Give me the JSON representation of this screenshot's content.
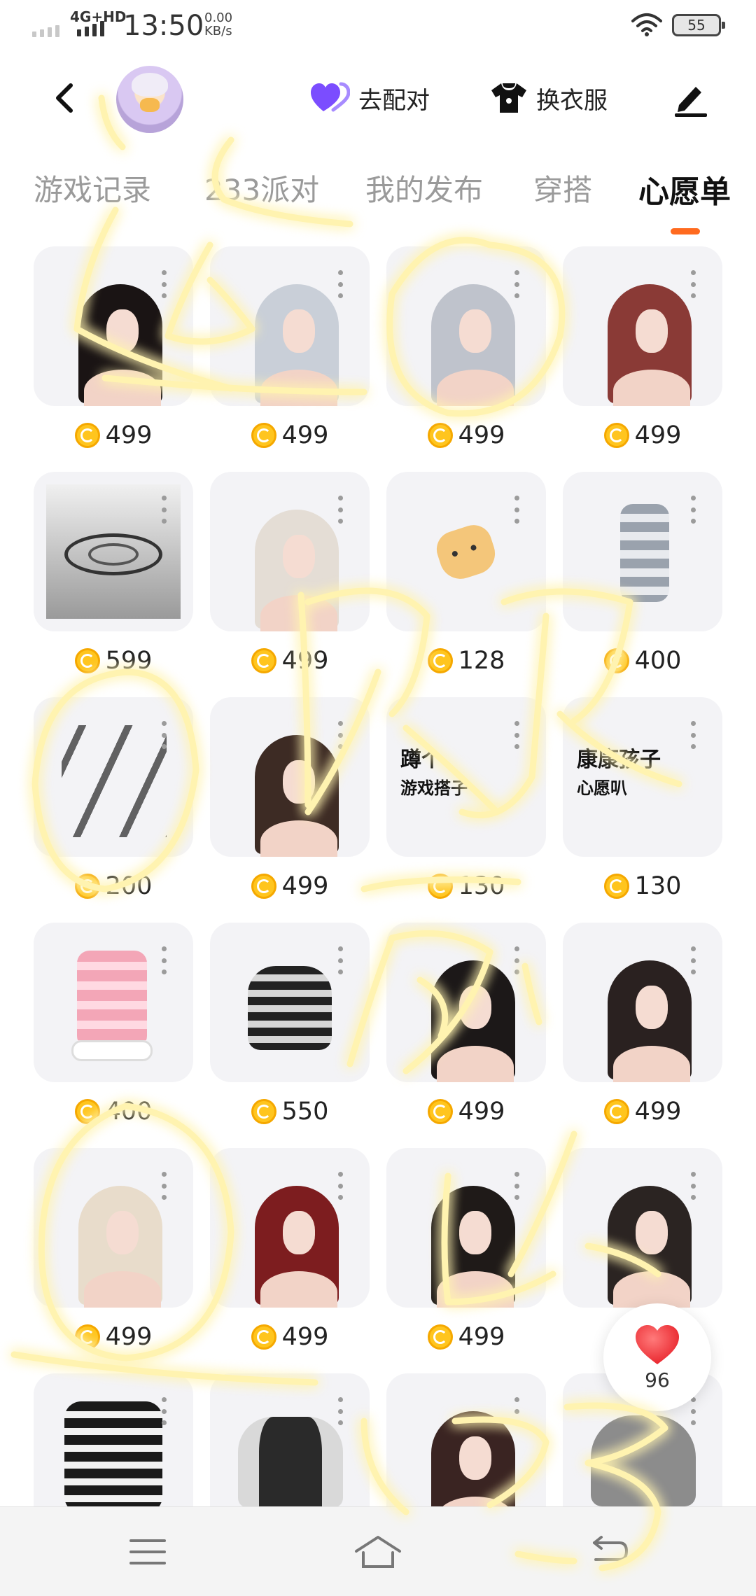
{
  "status_bar": {
    "network": "4G+HD",
    "time": "13:50",
    "speed_value": "0.00",
    "speed_unit": "KB/s",
    "battery": "55"
  },
  "header": {
    "pair_label": "去配对",
    "outfit_label": "换衣服",
    "pair_icon": "purple-heart-icon",
    "outfit_icon": "tshirt-icon",
    "edit_icon": "pen-icon"
  },
  "tabs": [
    {
      "label": "游戏记录"
    },
    {
      "label": "233派对"
    },
    {
      "label": "我的发布"
    },
    {
      "label": "穿搭"
    },
    {
      "label": "心愿单",
      "active": true
    }
  ],
  "items": [
    {
      "kind": "hair",
      "hair_color": "#1a1414",
      "price": "499"
    },
    {
      "kind": "hair",
      "hair_color": "#c9cfd8",
      "price": "499"
    },
    {
      "kind": "hair",
      "hair_color": "#bfc3cc",
      "price": "499"
    },
    {
      "kind": "hair",
      "hair_color": "#8a3a36",
      "price": "499"
    },
    {
      "kind": "platform",
      "price": "599"
    },
    {
      "kind": "hair",
      "hair_color": "#e4ddd5",
      "price": "499"
    },
    {
      "kind": "cookie",
      "price": "128"
    },
    {
      "kind": "socks-grey",
      "price": "400"
    },
    {
      "kind": "pattern",
      "price": "200"
    },
    {
      "kind": "hair",
      "hair_color": "#3d2b24",
      "price": "499"
    },
    {
      "kind": "text",
      "text_lines": [
        "蹲个",
        "游戏搭子"
      ],
      "price": "130"
    },
    {
      "kind": "text",
      "text_lines": [
        "康康孩子",
        "心愿叭"
      ],
      "price": "130"
    },
    {
      "kind": "socks-pink",
      "price": "400"
    },
    {
      "kind": "jacket-stripe",
      "price": "550"
    },
    {
      "kind": "hair",
      "hair_color": "#1c1818",
      "price": "499"
    },
    {
      "kind": "hair",
      "hair_color": "#2a2120",
      "price": "499"
    },
    {
      "kind": "hair",
      "hair_color": "#e8dccb",
      "price": "499"
    },
    {
      "kind": "hair",
      "hair_color": "#7d1d1f",
      "price": "499"
    },
    {
      "kind": "hair",
      "hair_color": "#1f1a18",
      "price": "499"
    },
    {
      "kind": "hair",
      "hair_color": "#2b2422",
      "price": ""
    },
    {
      "kind": "boots",
      "price": ""
    },
    {
      "kind": "jacket-varsity",
      "price": ""
    },
    {
      "kind": "hair",
      "hair_color": "#3a2422",
      "price": ""
    },
    {
      "kind": "hoodie-grey",
      "price": ""
    }
  ],
  "heart_float": {
    "count": "96",
    "icon": "red-heart-icon"
  },
  "bottom_nav": [
    {
      "icon": "menu-icon"
    },
    {
      "icon": "home-icon"
    },
    {
      "icon": "back-arrow-icon"
    }
  ],
  "colors": {
    "accent": "#ff6a1f",
    "coin": "#ffc51e",
    "scribble": "#ffd84a"
  }
}
